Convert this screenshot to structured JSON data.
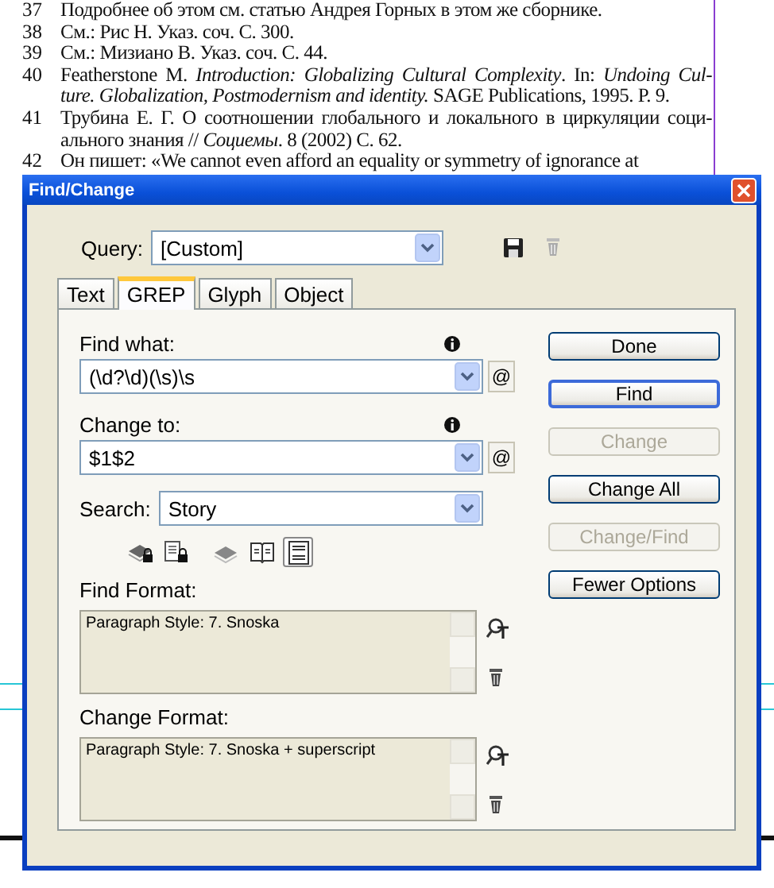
{
  "document": {
    "footnotes": [
      {
        "number": "37",
        "lines": [
          "Подробнее об этом см. статью Андрея Горных в этом же сборнике."
        ]
      },
      {
        "number": "38",
        "lines": [
          "См.: Рис Н. Указ. соч. С. 300."
        ]
      },
      {
        "number": "39",
        "lines": [
          "См.: Мизиано В. Указ. соч. С. 44."
        ]
      },
      {
        "number": "40",
        "lines": [
          "Featherstone M. *Introduction: Globalizing Cultural Complexity*. In: *Undoing Cul-*",
          "*ture. Globalization, Postmodernism and identity.* SAGE Publications, 1995. P. 9."
        ]
      },
      {
        "number": "41",
        "lines": [
          "Трубина Е. Г. О соотношении глобального и локального в циркуляции соци-",
          "ального знания // *Социемы*. 8 (2002) С. 62."
        ]
      },
      {
        "number": "42",
        "lines": [
          "Он пишет: «We cannot even afford an equality or symmetry of ignorance at"
        ]
      }
    ]
  },
  "dialog": {
    "title": "Find/Change",
    "query": {
      "label": "Query:",
      "value": "[Custom]"
    },
    "tabs": [
      {
        "label": "Text",
        "selected": false
      },
      {
        "label": "GREP",
        "selected": true
      },
      {
        "label": "Glyph",
        "selected": false
      },
      {
        "label": "Object",
        "selected": false
      }
    ],
    "find_what": {
      "label": "Find what:",
      "value": "(\\d?\\d)(\\s)\\s",
      "special_button": "@"
    },
    "change_to": {
      "label": "Change to:",
      "value": "$1$2",
      "special_button": "@"
    },
    "search": {
      "label": "Search:",
      "value": "Story"
    },
    "search_options": [
      {
        "on": false
      },
      {
        "on": false
      },
      {
        "on": false
      },
      {
        "on": false
      },
      {
        "on": true
      }
    ],
    "find_format": {
      "label": "Find Format:",
      "value": "Paragraph Style: 7. Snoska"
    },
    "change_format": {
      "label": "Change Format:",
      "value": "Paragraph Style: 7. Snoska + superscript"
    },
    "buttons": [
      {
        "label": "Done",
        "disabled": false,
        "default": false
      },
      {
        "label": "Find",
        "disabled": false,
        "default": true
      },
      {
        "label": "Change",
        "disabled": true,
        "default": false
      },
      {
        "label": "Change All",
        "disabled": false,
        "default": false
      },
      {
        "label": "Change/Find",
        "disabled": true,
        "default": false
      },
      {
        "label": "Fewer Options",
        "disabled": false,
        "default": false
      }
    ]
  }
}
